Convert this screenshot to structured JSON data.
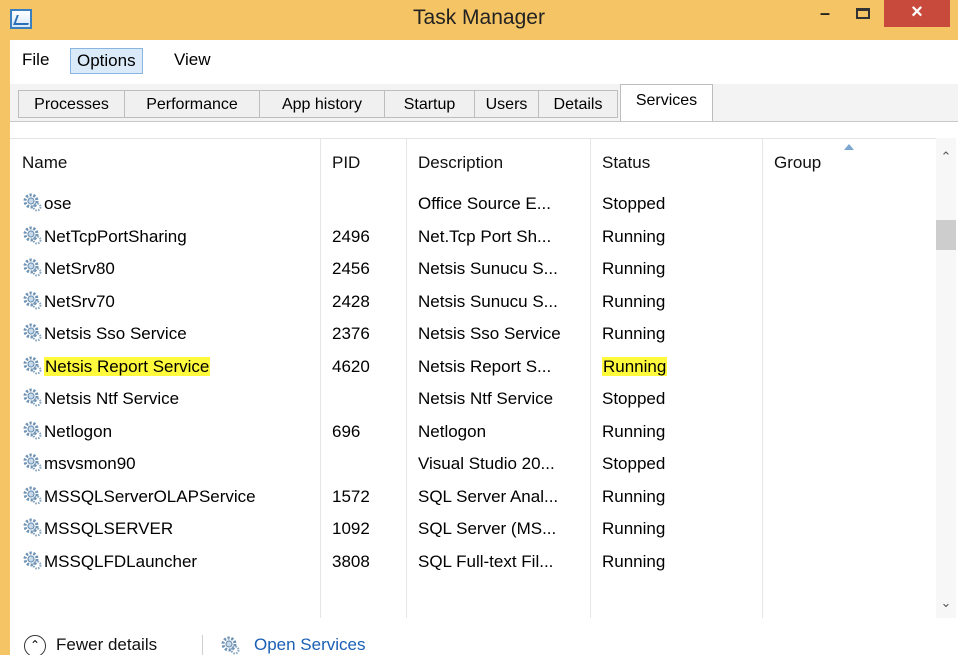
{
  "window": {
    "title": "Task Manager",
    "icon": "task-manager-icon",
    "controls": {
      "minimize": "–",
      "maximize": "maximize-icon",
      "close": "×"
    }
  },
  "menu": [
    "File",
    "Options",
    "View"
  ],
  "tabs": [
    "Processes",
    "Performance",
    "App history",
    "Startup",
    "Users",
    "Details",
    "Services"
  ],
  "active_tab": "Services",
  "columns": {
    "name": "Name",
    "pid": "PID",
    "description": "Description",
    "status": "Status",
    "group": "Group"
  },
  "services": [
    {
      "name": "ose",
      "pid": "",
      "description": "Office Source E...",
      "status": "Stopped"
    },
    {
      "name": "NetTcpPortSharing",
      "pid": "2496",
      "description": "Net.Tcp Port Sh...",
      "status": "Running"
    },
    {
      "name": "NetSrv80",
      "pid": "2456",
      "description": "Netsis Sunucu S...",
      "status": "Running"
    },
    {
      "name": "NetSrv70",
      "pid": "2428",
      "description": "Netsis Sunucu S...",
      "status": "Running"
    },
    {
      "name": "Netsis Sso Service",
      "pid": "2376",
      "description": "Netsis Sso Service",
      "status": "Running"
    },
    {
      "name": "Netsis Report Service",
      "pid": "4620",
      "description": "Netsis Report S...",
      "status": "Running",
      "highlighted": true
    },
    {
      "name": "Netsis Ntf Service",
      "pid": "",
      "description": "Netsis Ntf Service",
      "status": "Stopped"
    },
    {
      "name": "Netlogon",
      "pid": "696",
      "description": "Netlogon",
      "status": "Running"
    },
    {
      "name": "msvsmon90",
      "pid": "",
      "description": "Visual Studio 20...",
      "status": "Stopped"
    },
    {
      "name": "MSSQLServerOLAPService",
      "pid": "1572",
      "description": "SQL Server Anal...",
      "status": "Running"
    },
    {
      "name": "MSSQLSERVER",
      "pid": "1092",
      "description": "SQL Server (MS...",
      "status": "Running"
    },
    {
      "name": "MSSQLFDLauncher",
      "pid": "3808",
      "description": "SQL Full-text Fil...",
      "status": "Running"
    }
  ],
  "footer": {
    "fewer_details": "Fewer details",
    "open_services": "Open Services"
  },
  "colors": {
    "titlebar": "#f5c565",
    "close": "#c74a3c",
    "highlight": "#fffb3c",
    "link": "#1a5fb4"
  }
}
